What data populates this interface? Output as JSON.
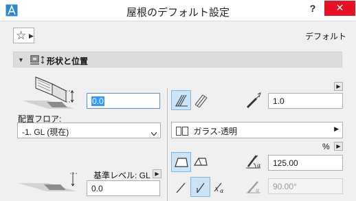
{
  "window": {
    "title": "屋根のデフォルト設定",
    "help_label": "?",
    "close_label": "✕"
  },
  "toolbar": {
    "favorites_icon": "star-icon",
    "default_label": "デフォルト"
  },
  "section": {
    "title": "形状と位置",
    "expanded": true
  },
  "left": {
    "thickness_value": "0.0",
    "floor_label": "配置フロア:",
    "floor_value": "-1. GL (現在)",
    "ref_level_label": "基準レベル: GL",
    "ref_level_value": "0.0"
  },
  "right": {
    "ratio_value": "1.0",
    "material_value": "ガラス-透明",
    "unit_label": "%",
    "slope_value": "125.00",
    "angle_value": "90.00°"
  }
}
